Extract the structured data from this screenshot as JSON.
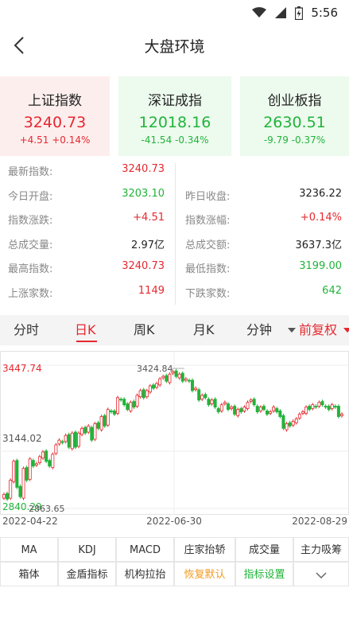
{
  "status": {
    "time": "5:56",
    "icons": [
      "wifi-icon",
      "signal-icon",
      "battery-icon"
    ]
  },
  "header": {
    "title": "大盘环境",
    "back_icon": "back-arrow-icon"
  },
  "indices": [
    {
      "name": "上证指数",
      "value": "3240.73",
      "change": "+4.51  +0.14%",
      "trend": "up"
    },
    {
      "name": "深证成指",
      "value": "12018.16",
      "change": "-41.54  -0.34%",
      "trend": "down"
    },
    {
      "name": "创业板指",
      "value": "2630.51",
      "change": "-9.79  -0.37%",
      "trend": "down"
    }
  ],
  "stats": [
    {
      "l_label": "最新指数:",
      "l_value": "3240.73",
      "l_color": "red",
      "r_label": "",
      "r_value": "",
      "r_color": ""
    },
    {
      "l_label": "今日开盘:",
      "l_value": "3203.10",
      "l_color": "green",
      "r_label": "昨日收盘:",
      "r_value": "3236.22",
      "r_color": "black"
    },
    {
      "l_label": "指数涨跌:",
      "l_value": "+4.51",
      "l_color": "red",
      "r_label": "指数涨幅:",
      "r_value": "+0.14%",
      "r_color": "red"
    },
    {
      "l_label": "总成交量:",
      "l_value": "2.97亿",
      "l_color": "black",
      "r_label": "总成交额:",
      "r_value": "3637.3亿",
      "r_color": "black"
    },
    {
      "l_label": "最高指数:",
      "l_value": "3240.73",
      "l_color": "red",
      "r_label": "最低指数:",
      "r_value": "3199.00",
      "r_color": "green"
    },
    {
      "l_label": "上涨家数:",
      "l_value": "1149",
      "l_color": "red",
      "r_label": "下跌家数:",
      "r_value": "642",
      "r_color": "green"
    }
  ],
  "period_tabs": {
    "items": [
      "分时",
      "日K",
      "周K",
      "月K",
      "分钟",
      "前复权"
    ],
    "active": "日K"
  },
  "chart_data": {
    "type": "candlestick",
    "y_labels": {
      "top": "3447.74",
      "mid": "3144.02",
      "bottom": "2840.29"
    },
    "annotations": {
      "high": "3424.84",
      "low": "2863.65"
    },
    "x_labels": [
      "2022-04-22",
      "2022-06-30",
      "2022-08-29"
    ],
    "ylim": [
      2840.29,
      3447.74
    ],
    "close_series": [
      2900,
      2880,
      2960,
      3040,
      2930,
      2890,
      3010,
      2960,
      3050,
      3020,
      3030,
      3060,
      3080,
      3040,
      3020,
      3070,
      3110,
      3130,
      3120,
      3150,
      3100,
      3160,
      3100,
      3160,
      3180,
      3160,
      3190,
      3130,
      3200,
      3180,
      3230,
      3190,
      3260,
      3250,
      3240,
      3310,
      3300,
      3280,
      3260,
      3290,
      3270,
      3320,
      3340,
      3310,
      3340,
      3360,
      3350,
      3370,
      3390,
      3400,
      3380,
      3410,
      3420,
      3400,
      3410,
      3380,
      3390,
      3380,
      3340,
      3350,
      3300,
      3320,
      3310,
      3280,
      3300,
      3270,
      3250,
      3280,
      3290,
      3260,
      3270,
      3240,
      3260,
      3250,
      3270,
      3290,
      3300,
      3280,
      3250,
      3270,
      3260,
      3240,
      3250,
      3270,
      3250,
      3230,
      3180,
      3200,
      3190,
      3210,
      3220,
      3240,
      3250,
      3270,
      3260,
      3280,
      3270,
      3290,
      3280,
      3270,
      3260,
      3280,
      3270,
      3230,
      3240
    ],
    "grid": true
  },
  "indicators": {
    "row1": [
      "MA",
      "KDJ",
      "MACD",
      "庄家抬轿",
      "成交量",
      "主力吸筹"
    ],
    "row2": [
      "箱体",
      "金盾指标",
      "机构拉抬",
      "恢复默认",
      "指标设置"
    ],
    "expand_icon": "chevron-down-icon"
  },
  "colors": {
    "up": "#e5282f",
    "down": "#21b43a",
    "orange": "#f39a1e"
  }
}
